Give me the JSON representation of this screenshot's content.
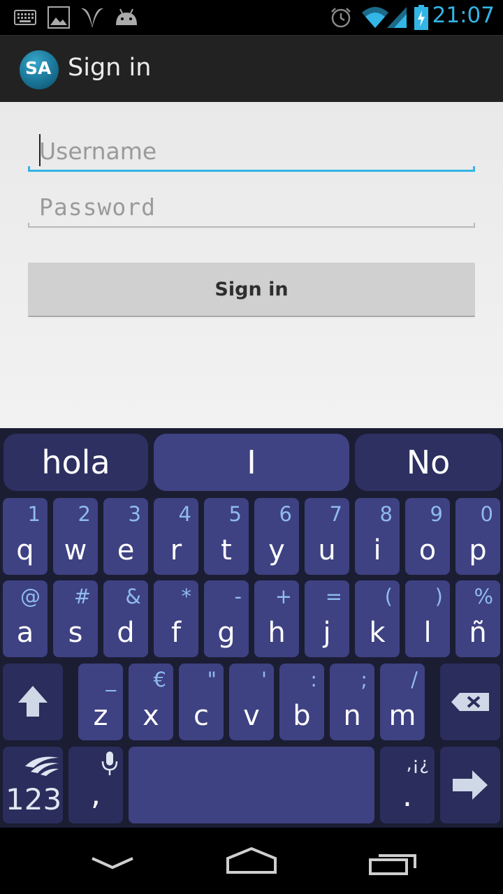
{
  "status_bar": {
    "time": "21:07",
    "icons": [
      "keyboard-icon",
      "image-icon",
      "swiftkey-icon",
      "android-icon",
      "alarm-icon",
      "wifi-icon",
      "signal-icon",
      "battery-charging-icon"
    ]
  },
  "action_bar": {
    "logo_text": "SA",
    "title": "Sign in"
  },
  "form": {
    "username_placeholder": "Username",
    "password_placeholder": "Password",
    "submit_label": "Sign in"
  },
  "keyboard": {
    "suggestions": [
      "hola",
      "I",
      "No"
    ],
    "row1": [
      {
        "main": "q",
        "alt": "1"
      },
      {
        "main": "w",
        "alt": "2"
      },
      {
        "main": "e",
        "alt": "3"
      },
      {
        "main": "r",
        "alt": "4"
      },
      {
        "main": "t",
        "alt": "5"
      },
      {
        "main": "y",
        "alt": "6"
      },
      {
        "main": "u",
        "alt": "7"
      },
      {
        "main": "i",
        "alt": "8"
      },
      {
        "main": "o",
        "alt": "9"
      },
      {
        "main": "p",
        "alt": "0"
      }
    ],
    "row2": [
      {
        "main": "a",
        "alt": "@"
      },
      {
        "main": "s",
        "alt": "#"
      },
      {
        "main": "d",
        "alt": "&"
      },
      {
        "main": "f",
        "alt": "*"
      },
      {
        "main": "g",
        "alt": "-"
      },
      {
        "main": "h",
        "alt": "+"
      },
      {
        "main": "j",
        "alt": "="
      },
      {
        "main": "k",
        "alt": "("
      },
      {
        "main": "l",
        "alt": ")"
      },
      {
        "main": "ñ",
        "alt": "%"
      }
    ],
    "row3": [
      {
        "main": "z",
        "alt": "_"
      },
      {
        "main": "x",
        "alt": "€"
      },
      {
        "main": "c",
        "alt": "\""
      },
      {
        "main": "v",
        "alt": "'"
      },
      {
        "main": "b",
        "alt": ":"
      },
      {
        "main": "n",
        "alt": ";"
      },
      {
        "main": "m",
        "alt": "/"
      }
    ],
    "numbers_label": "123",
    "comma_label": ",",
    "period_label": ".",
    "period_alt": ",¡¿",
    "colors": {
      "key": "#3e4182",
      "key_dark": "#2b2d5c",
      "alt_text": "#8fbaf0",
      "accent": "#33b5e5"
    }
  },
  "nav_bar": {
    "icons": [
      "back-icon",
      "home-icon",
      "recent-apps-icon"
    ]
  }
}
